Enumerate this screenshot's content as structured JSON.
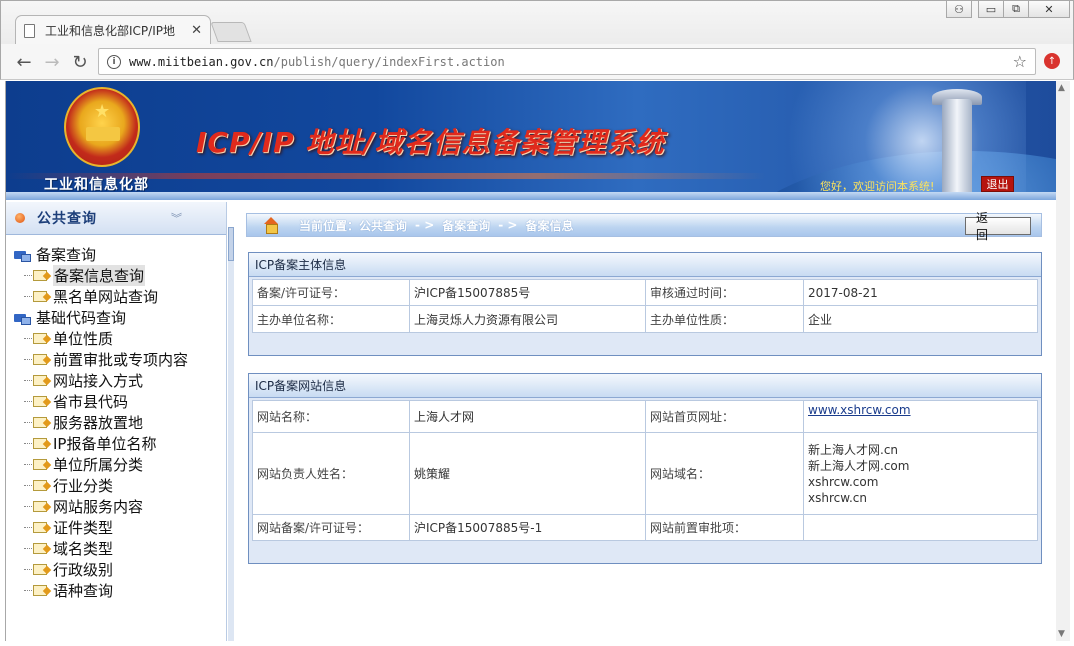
{
  "browser": {
    "tab_title": "工业和信息化部ICP/IP地",
    "url_host": "www.miitbeian.gov.cn",
    "url_path": "/publish/query/indexFirst.action",
    "icons": [
      "page-icon",
      "close-icon",
      "back-icon",
      "forward-icon",
      "reload-icon",
      "info-icon",
      "star-icon",
      "extension-icon",
      "user-icon",
      "minimize-icon",
      "maximize-icon",
      "window-close-icon"
    ]
  },
  "banner": {
    "ministry": "工业和信息化部",
    "system_title": "ICP/IP 地址/域名信息备案管理系统",
    "welcome": "您好，欢迎访问本系统!",
    "logout": "退出"
  },
  "sidebar": {
    "header": "公共查询",
    "groups": [
      {
        "label": "备案查询",
        "items": [
          "备案信息查询",
          "黑名单网站查询"
        ],
        "selected": "备案信息查询"
      },
      {
        "label": "基础代码查询",
        "items": [
          "单位性质",
          "前置审批或专项内容",
          "网站接入方式",
          "省市县代码",
          "服务器放置地",
          "IP报备单位名称",
          "单位所属分类",
          "行业分类",
          "网站服务内容",
          "证件类型",
          "域名类型",
          "行政级别",
          "语种查询"
        ]
      }
    ]
  },
  "breadcrumb": {
    "prefix": "当前位置：",
    "items": [
      "公共查询",
      "备案查询",
      "备案信息"
    ],
    "separator": "- >",
    "back": "返 回"
  },
  "subject_panel": {
    "title": "ICP备案主体信息",
    "license_label": "备案/许可证号：",
    "license_value": "沪ICP备15007885号",
    "approve_label": "审核通过时间：",
    "approve_value": "2017-08-21",
    "org_label": "主办单位名称：",
    "org_value": "上海灵烁人力资源有限公司",
    "type_label": "主办单位性质：",
    "type_value": "企业"
  },
  "site_panel": {
    "title": "ICP备案网站信息",
    "name_label": "网站名称：",
    "name_value": "上海人才网",
    "home_label": "网站首页网址：",
    "home_value": "www.xshrcw.com",
    "owner_label": "网站负责人姓名：",
    "owner_value": "姚策耀",
    "domain_label": "网站域名：",
    "domains": [
      "新上海人才网.cn",
      "新上海人才网.com",
      "xshrcw.com",
      "xshrcw.cn"
    ],
    "site_license_label": "网站备案/许可证号：",
    "site_license_value": "沪ICP备15007885号-1",
    "preapproval_label": "网站前置审批项：",
    "preapproval_value": ""
  },
  "colors": {
    "banner_blue": "#12489e",
    "title_red": "#e02a1c",
    "welcome_yellow": "#ffe45a",
    "panel_border": "#6f8fc0"
  }
}
